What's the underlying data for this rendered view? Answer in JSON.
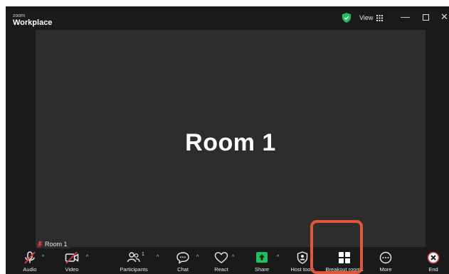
{
  "title_bar": {
    "brand_small": "zoom",
    "brand_big": "Workplace",
    "view_label": "View"
  },
  "stage": {
    "room_name": "Room 1",
    "participant_tag": "Room 1"
  },
  "toolbar": {
    "audio": "Audio",
    "video": "Video",
    "participants": "Participants",
    "participants_count": "1",
    "chat": "Chat",
    "react": "React",
    "share": "Share",
    "host_tools": "Host tools",
    "breakout_rooms": "Breakout rooms",
    "more": "More",
    "end": "End"
  },
  "colors": {
    "accent_share": "#1fbf5b",
    "shield": "#1fbf5b",
    "muted_red": "#e23b3b",
    "highlight": "#e0583b"
  }
}
